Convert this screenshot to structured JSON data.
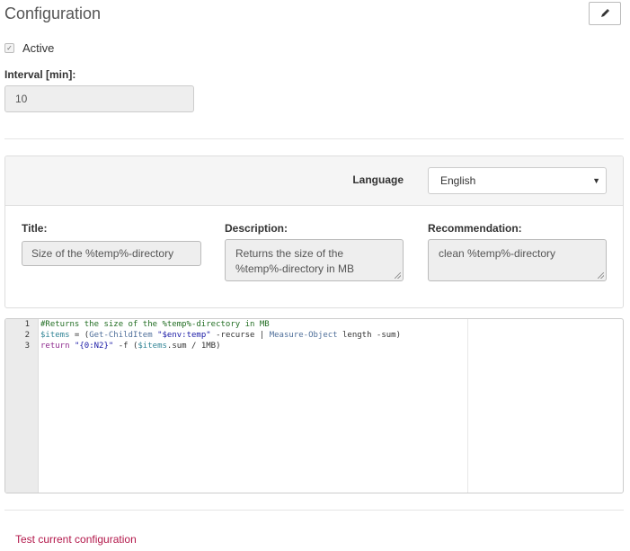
{
  "header": {
    "title": "Configuration",
    "edit_icon": "pencil-icon"
  },
  "active": {
    "label": "Active",
    "checked": true
  },
  "interval": {
    "label": "Interval [min]:",
    "value": "10"
  },
  "language": {
    "label": "Language",
    "selected": "English"
  },
  "fields": {
    "title": {
      "label": "Title:",
      "value": "Size of the %temp%-directory"
    },
    "description": {
      "label": "Description:",
      "value": "Returns the size of the %temp%-directory in MB"
    },
    "recommendation": {
      "label": "Recommendation:",
      "value": "clean %temp%-directory"
    }
  },
  "editor": {
    "line_numbers": [
      "1",
      "2",
      "3"
    ],
    "lines": [
      [
        {
          "t": "#Returns the size of the %temp%-directory in MB",
          "c": "comment"
        }
      ],
      [
        {
          "t": "$items",
          "c": "var"
        },
        {
          "t": " = (",
          "c": ""
        },
        {
          "t": "Get-ChildItem",
          "c": "cmd"
        },
        {
          "t": " ",
          "c": ""
        },
        {
          "t": "\"$env:temp\"",
          "c": "str"
        },
        {
          "t": " -recurse | ",
          "c": ""
        },
        {
          "t": "Measure-Object",
          "c": "cmd"
        },
        {
          "t": " length -sum)",
          "c": ""
        }
      ],
      [
        {
          "t": "return",
          "c": "kw"
        },
        {
          "t": " ",
          "c": ""
        },
        {
          "t": "\"{0:N2}\"",
          "c": "str"
        },
        {
          "t": " -f (",
          "c": ""
        },
        {
          "t": "$items",
          "c": "var"
        },
        {
          "t": ".sum / 1MB)",
          "c": ""
        }
      ]
    ]
  },
  "footer": {
    "test_link": "Test current configuration"
  }
}
